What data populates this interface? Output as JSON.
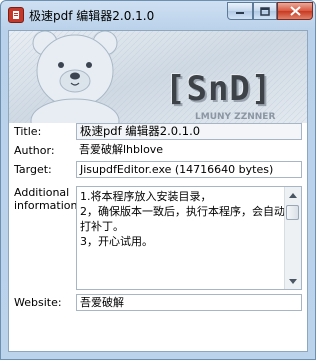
{
  "window": {
    "title": "极速pdf 编辑器2.0.1.0",
    "icon": "pdf-app-icon",
    "controls": {
      "minimize": "minimize-icon",
      "maximize": "maximize-icon",
      "close": "close-icon"
    }
  },
  "banner": {
    "logo_text": "[SnD]",
    "image": "teddy-bear-artwork"
  },
  "fields": {
    "title_label": "Title:",
    "title_value": "极速pdf 编辑器2.0.1.0",
    "author_label": "Author:",
    "author_value": "吾爱破解lhblove",
    "target_label": "Target:",
    "target_value": "JisupdfEditor.exe (14716640 bytes)",
    "info_label": "Additional\ninformation:",
    "info_value": "1.将本程序放入安装目录，\n2，确保版本一致后，执行本程序，会自动打补丁。\n3，开心试用。",
    "website_label": "Website:",
    "website_value": "吾爱破解"
  },
  "colors": {
    "titlebar": "#b9d1ea",
    "close_button": "#c73a20",
    "banner_bg": "#dde6ef"
  }
}
